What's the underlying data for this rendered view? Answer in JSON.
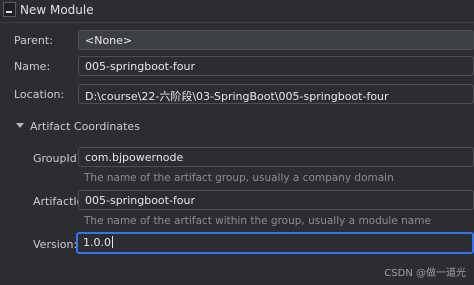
{
  "window": {
    "title": "New Module",
    "icon": "app-icon"
  },
  "form": {
    "parent": {
      "label": "Parent:",
      "value": "<None>"
    },
    "name": {
      "label": "Name:",
      "value": "005-springboot-four"
    },
    "location": {
      "label": "Location:",
      "value": "D:\\course\\22-六阶段\\03-SpringBoot\\005-springboot-four"
    }
  },
  "artifact": {
    "section_title": "Artifact Coordinates",
    "group_id": {
      "label": "GroupId:",
      "value": "com.bjpowernode",
      "hint": "The name of the artifact group, usually a company domain"
    },
    "artifact_id": {
      "label": "ArtifactId:",
      "value": "005-springboot-four",
      "hint": "The name of the artifact within the group, usually a module name"
    },
    "version": {
      "label": "Version:",
      "value": "1.0.0"
    }
  },
  "watermark": "CSDN @做一道光",
  "colors": {
    "background": "#2b2d30",
    "accent": "#3574f0"
  }
}
